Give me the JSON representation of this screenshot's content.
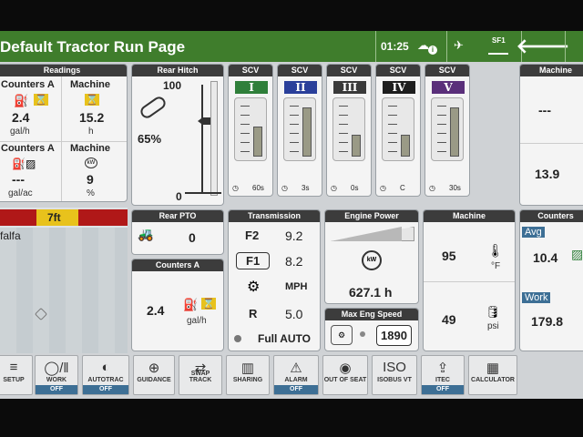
{
  "title_bar": {
    "title": "Default Tractor Run Page",
    "time": "01:25",
    "gps_label": "SF1",
    "back_icon": "arrow-left-icon"
  },
  "readings": {
    "header": "Readings",
    "counters_a_1": {
      "label": "Counters A",
      "value": "2.4",
      "unit": "gal/h"
    },
    "machine_1": {
      "label": "Machine",
      "value": "15.2",
      "unit": "h"
    },
    "counters_a_2": {
      "label": "Counters A",
      "value": "---",
      "unit": "gal/ac"
    },
    "machine_2": {
      "label": "Machine",
      "value": "9",
      "unit": "%"
    }
  },
  "rear_hitch": {
    "header": "Rear Hitch",
    "max": "100",
    "min": "0",
    "percent": "65%",
    "level": 0.65
  },
  "scv": [
    {
      "header": "SCV",
      "numeral": "I",
      "color": "#2f7f3a",
      "timer": "60s",
      "level": 0.55
    },
    {
      "header": "SCV",
      "numeral": "II",
      "color": "#2a3f9a",
      "timer": "3s",
      "level": 0.9
    },
    {
      "header": "SCV",
      "numeral": "III",
      "color": "#3a3a3a",
      "timer": "0s",
      "level": 0.4
    },
    {
      "header": "SCV",
      "numeral": "IV",
      "color": "#1e1e1e",
      "timer": "C",
      "level": 0.4
    },
    {
      "header": "SCV",
      "numeral": "V",
      "color": "#5a2f7a",
      "timer": "30s",
      "level": 0.9
    }
  ],
  "right_machine": {
    "header": "Machine",
    "value1": "---",
    "value2": "13.9"
  },
  "map": {
    "width_label": "7ft",
    "field_name": "falfa"
  },
  "rear_pto": {
    "header": "Rear PTO",
    "value": "0"
  },
  "counters_a_card": {
    "header": "Counters A",
    "value": "2.4",
    "unit": "gal/h"
  },
  "transmission": {
    "header": "Transmission",
    "f2": "F2",
    "f2_speed": "9.2",
    "f1": "F1",
    "f1_speed": "8.2",
    "unit": "MPH",
    "r": "R",
    "r_speed": "5.0",
    "mode": "Full AUTO"
  },
  "engine_power": {
    "header": "Engine Power",
    "hours": "627.1 h",
    "level": 0.85
  },
  "max_eng_speed": {
    "header": "Max Eng Speed",
    "value": "1890"
  },
  "machine_card": {
    "header": "Machine",
    "temp_value": "95",
    "temp_unit": "°F",
    "psi_value": "49",
    "psi_unit": "psi"
  },
  "counters_right": {
    "header": "Counters",
    "avg_label": "Avg",
    "avg_value": "10.4",
    "work_label": "Work",
    "work_value": "179.8"
  },
  "bottom_bar": [
    {
      "label": "SETUP",
      "status": ""
    },
    {
      "label": "WORK",
      "status": "OFF"
    },
    {
      "label": "AUTOTRAC",
      "status": "OFF"
    },
    {
      "label": "GUIDANCE",
      "status": ""
    },
    {
      "label": "SWAP TRACK",
      "status": ""
    },
    {
      "label": "SHARING",
      "status": ""
    },
    {
      "label": "ALARM",
      "status": "OFF"
    },
    {
      "label": "OUT OF SEAT",
      "status": ""
    },
    {
      "label": "ISOBUS VT",
      "status": ""
    },
    {
      "label": "ITEC",
      "status": "OFF"
    },
    {
      "label": "CALCULATOR",
      "status": ""
    }
  ]
}
